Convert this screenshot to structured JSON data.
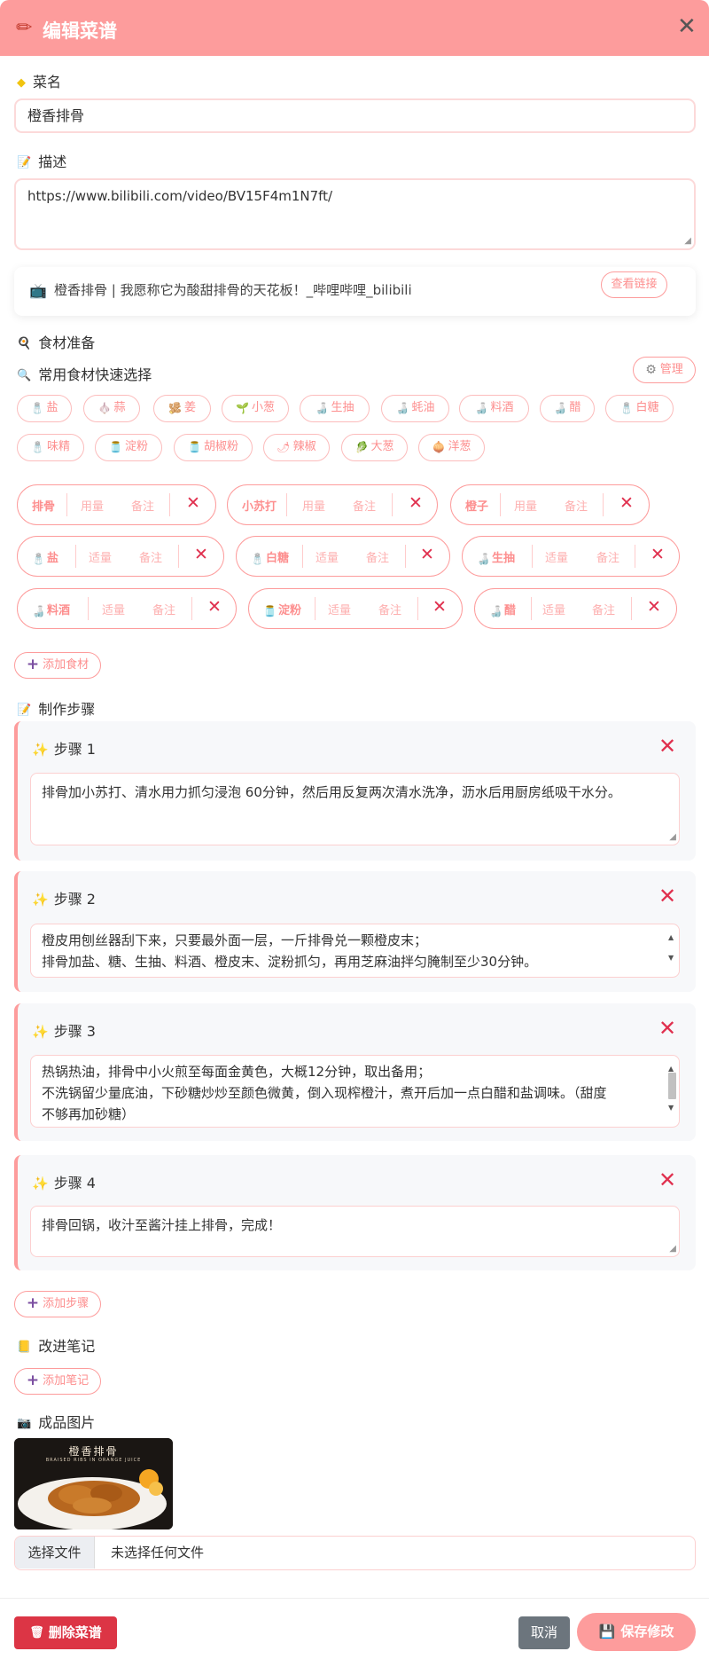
{
  "header": {
    "title": "编辑菜谱",
    "icon": "pencil-icon"
  },
  "name": {
    "label": "菜名",
    "value": "橙香排骨"
  },
  "description": {
    "label": "描述",
    "value": "https://www.bilibili.com/video/BV15F4m1N7ft/"
  },
  "link_preview": {
    "title": "橙香排骨 | 我愿称它为酸甜排骨的天花板！_哔哩哔哩_bilibili",
    "button": "查看链接"
  },
  "ingredients": {
    "label": "食材准备",
    "quick_label": "常用食材快速选择",
    "manage": "管理",
    "quick": [
      "盐",
      "蒜",
      "姜",
      "小葱",
      "生抽",
      "蚝油",
      "料酒",
      "醋",
      "白糖",
      "味精",
      "淀粉",
      "胡椒粉",
      "辣椒",
      "大葱",
      "洋葱"
    ],
    "qty_placeholder": "用量",
    "note_placeholder": "备注",
    "qty_value": "适量",
    "items": [
      "排骨",
      "小苏打",
      "橙子",
      "盐",
      "白糖",
      "生抽",
      "料酒",
      "淀粉",
      "醋"
    ],
    "add": "添加食材"
  },
  "steps": {
    "label": "制作步骤",
    "items": [
      {
        "title": "步骤 1",
        "text": "排骨加小苏打、清水用力抓匀浸泡 60分钟，然后用反复两次清水洗净，沥水后用厨房纸吸干水分。"
      },
      {
        "title": "步骤 2",
        "line1": "橙皮用刨丝器刮下来，只要最外面一层，一斤排骨兑一颗橙皮末；",
        "line2": "排骨加盐、糖、生抽、料酒、橙皮末、淀粉抓匀，再用芝麻油拌匀腌制至少30分钟。"
      },
      {
        "title": "步骤 3",
        "line1": "热锅热油，排骨中小火煎至每面金黄色，大概12分钟，取出备用；",
        "line2": "不洗锅留少量底油，下砂糖炒炒至颜色微黄，倒入现榨橙汁，煮开后加一点白醋和盐调味。（甜度",
        "line3": "不够再加砂糖）"
      },
      {
        "title": "步骤 4",
        "text": "排骨回锅，收汁至酱汁挂上排骨，完成！"
      }
    ],
    "add": "添加步骤"
  },
  "notes": {
    "label": "改进笔记",
    "add": "添加笔记"
  },
  "photo": {
    "label": "成品图片",
    "caption_cn": "橙香排骨",
    "caption_en": "BRAISED RIBS IN ORANGE JUICE",
    "file_button": "选择文件",
    "file_status": "未选择任何文件"
  },
  "footer": {
    "delete": "删除菜谱",
    "cancel": "取消",
    "save": "保存修改"
  },
  "colors": {
    "accent": "#fd9c9c",
    "danger": "#dc3545",
    "close_red": "#e0304e",
    "neutral": "#6c757d"
  }
}
